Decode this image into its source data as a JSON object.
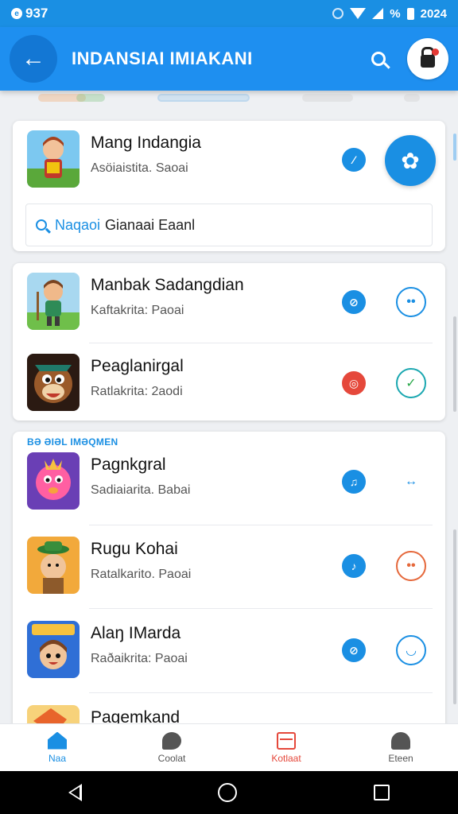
{
  "status_bar": {
    "left_time": "937",
    "percent": "%",
    "right_year": "2024"
  },
  "app_bar": {
    "title": "INDANSIAI IMIAKANI"
  },
  "featured": {
    "name": "Mang Indangia",
    "subtitle": "Asöiaistita. Saoai",
    "search_highlight": "Naqaoi",
    "search_text": "Gianaai Eaanl"
  },
  "group_one": [
    {
      "name": "Manbak Sadangdian",
      "subtitle": "Kaftakrita: Paoai",
      "icon1": "pencil-icon",
      "icon2": "controller-icon",
      "color1": "#1a8fe3",
      "color2": "#1a8fe3",
      "glyph1": "⊘",
      "glyph2": "••"
    },
    {
      "name": "Peaglanirgal",
      "subtitle": "Ratlakrita: 2aodi",
      "icon1": "camera-icon",
      "icon2": "check-icon",
      "color1": "#e5483b",
      "color2": "#1aa7b0",
      "glyph1": "◎",
      "glyph2": "✓"
    }
  ],
  "section_label": "BƏ ƏIƏL IMƏQMEN",
  "group_two": [
    {
      "name": "Pagnkgral",
      "subtitle": "Sadiaiarita. Babai",
      "icon1": "music-icon",
      "icon2": "link-icon",
      "color1": "#1a8fe3",
      "color2": "#1a8fe3",
      "glyph1": "♫",
      "glyph2": "↔"
    },
    {
      "name": "Rugu Kohai",
      "subtitle": "Ratalkarito. Paoai",
      "icon1": "music-icon",
      "icon2": "dots-icon",
      "color1": "#1a8fe3",
      "color2": "#e5683b",
      "glyph1": "♪",
      "glyph2": "••"
    },
    {
      "name": "Alaŋ IMarda",
      "subtitle": "Raðaikrita: Paoai",
      "icon1": "compass-icon",
      "icon2": "smile-icon",
      "color1": "#1a8fe3",
      "color2": "#1a8fe3",
      "glyph1": "⊘",
      "glyph2": "◡"
    },
    {
      "name": "Pagemkand"
    }
  ],
  "bottom_nav": [
    {
      "label": "Naa",
      "icon": "home-icon"
    },
    {
      "label": "Coolat",
      "icon": "chat-icon"
    },
    {
      "label": "Kotlaat",
      "icon": "news-icon"
    },
    {
      "label": "Eteen",
      "icon": "profile-icon"
    }
  ]
}
